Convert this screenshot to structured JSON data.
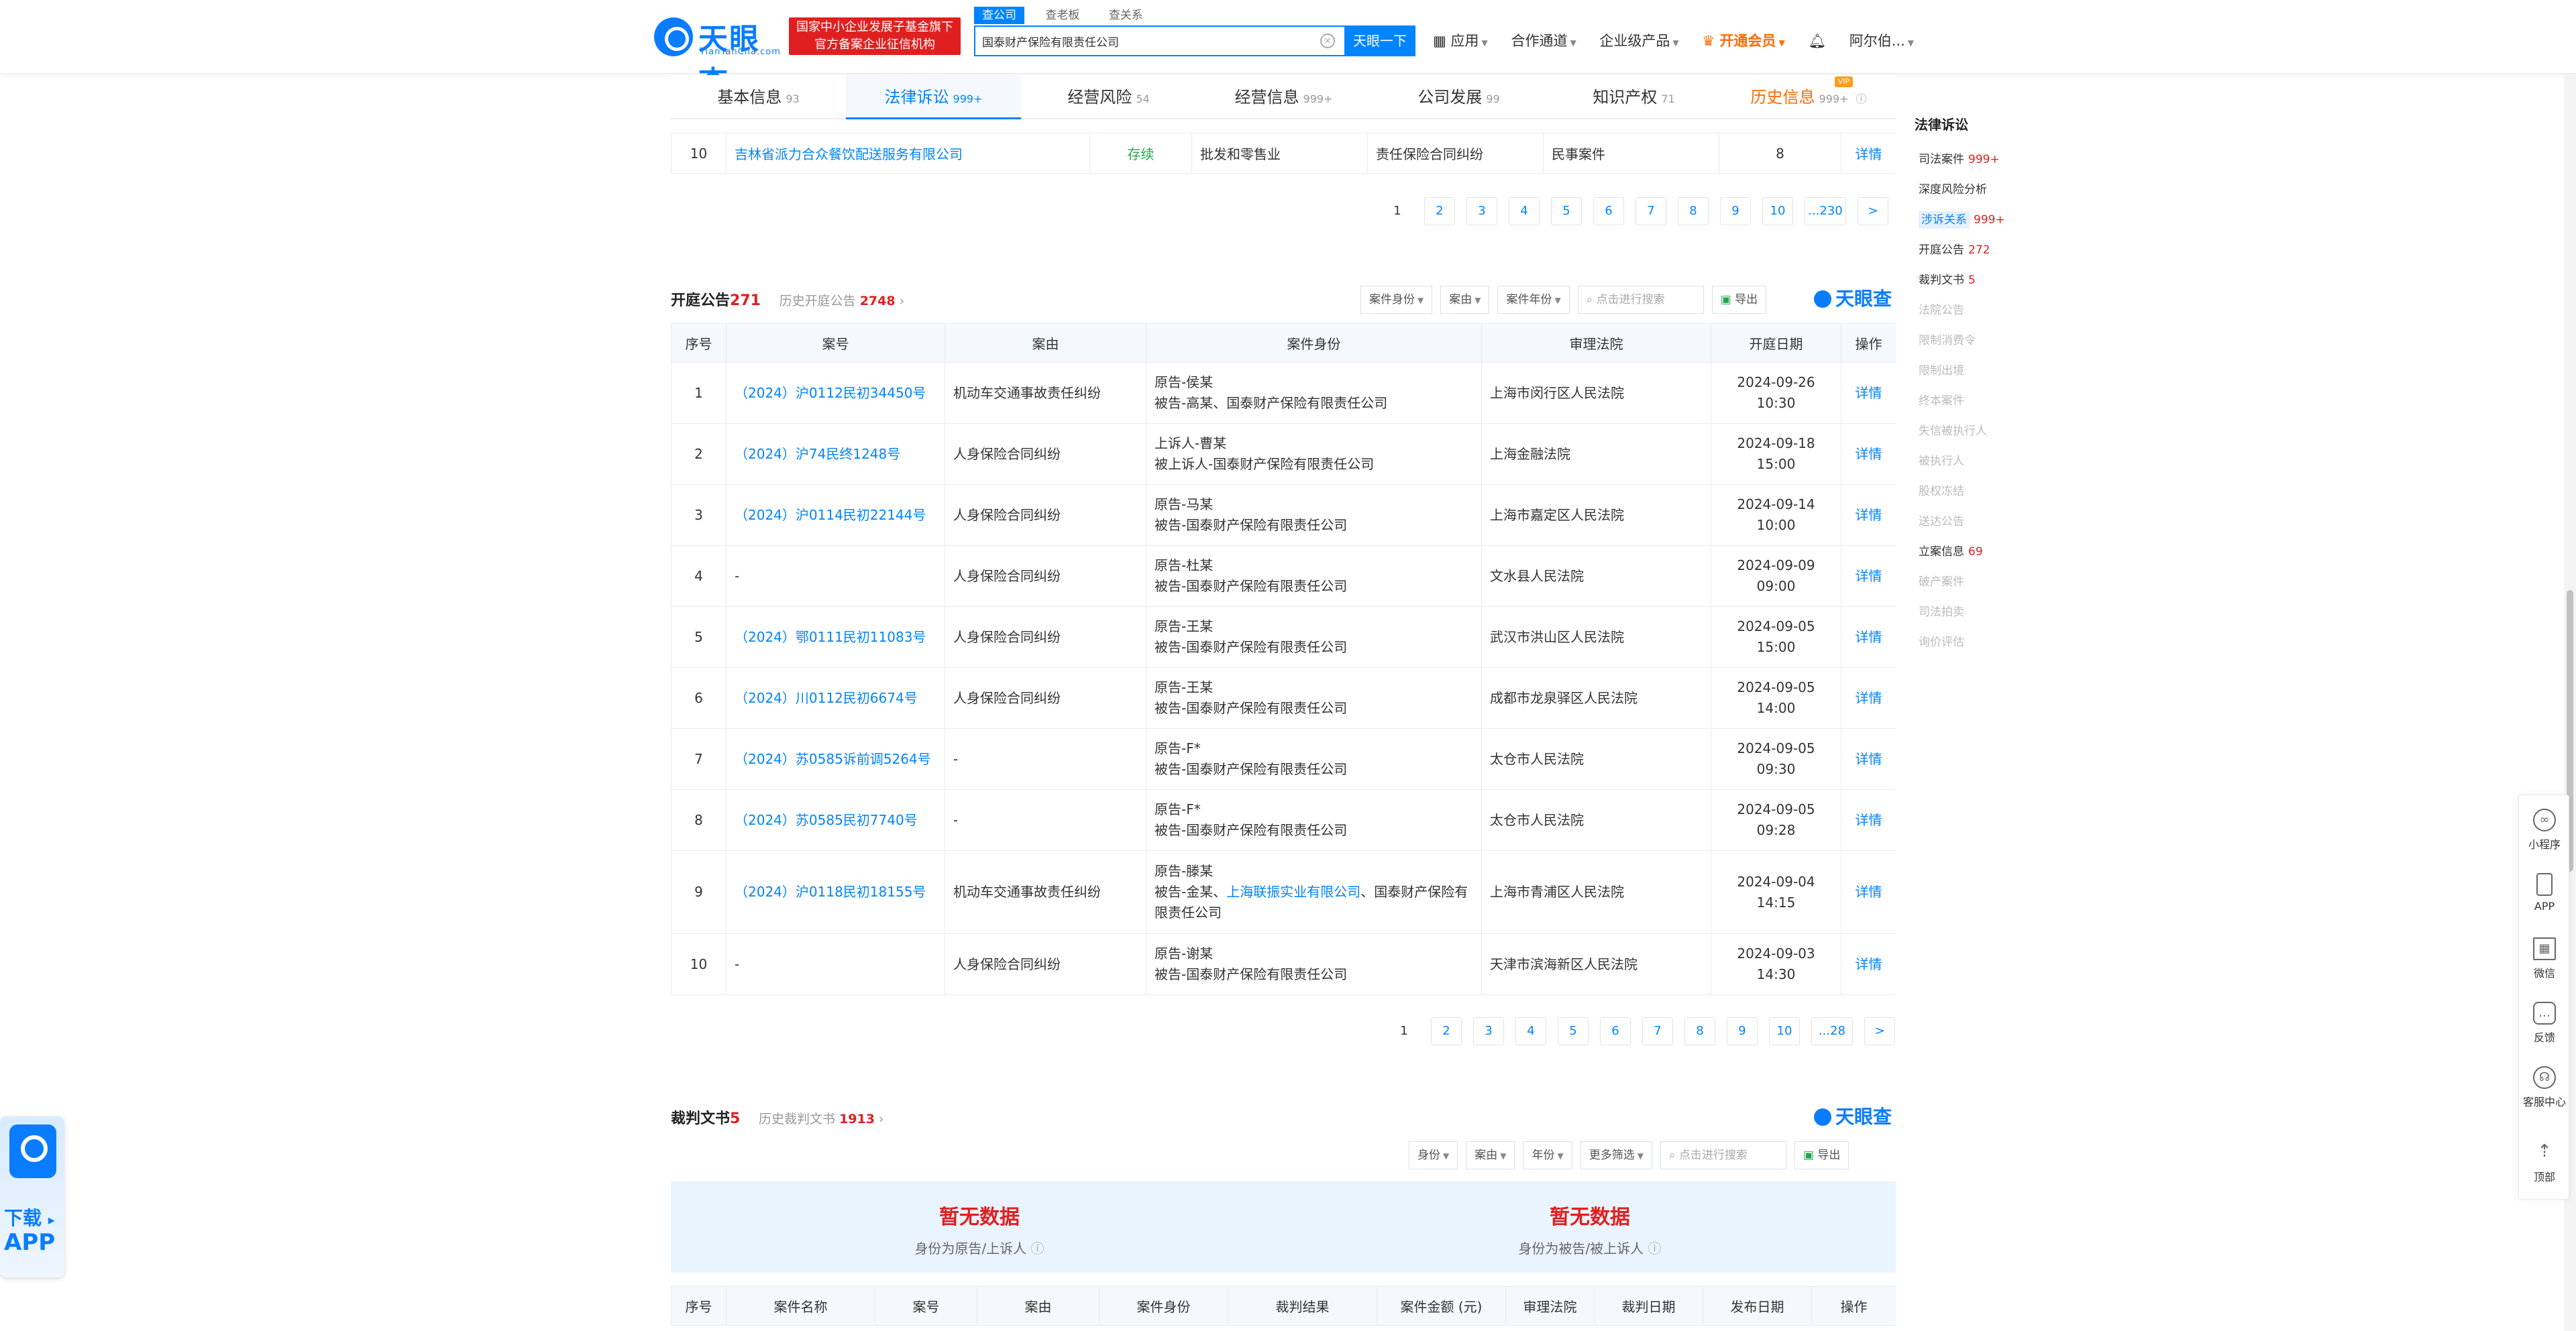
{
  "header": {
    "logo_text": "天眼查",
    "logo_sub": "TianYanCha.com",
    "org_badge_line1": "国家中小企业发展子基金旗下",
    "org_badge_line2": "官方备案企业征信机构",
    "search_tabs": [
      "查公司",
      "查老板",
      "查关系"
    ],
    "search_value": "国泰财产保险有限责任公司",
    "search_button": "天眼一下",
    "nav": [
      "应用",
      "合作通道",
      "企业级产品",
      "开通会员",
      "阿尔伯..."
    ]
  },
  "tabs": [
    {
      "label": "基本信息",
      "count": "93"
    },
    {
      "label": "法律诉讼",
      "count": "999+"
    },
    {
      "label": "经营风险",
      "count": "54"
    },
    {
      "label": "经营信息",
      "count": "999+"
    },
    {
      "label": "公司发展",
      "count": "99"
    },
    {
      "label": "知识产权",
      "count": "71"
    },
    {
      "label": "历史信息",
      "count": "999+",
      "badge": "VIP"
    }
  ],
  "prev_row": {
    "no": "10",
    "company": "吉林省派力合众餐饮配送服务有限公司",
    "status": "存续",
    "industry": "批发和零售业",
    "cause": "责任保险合同纠纷",
    "type": "民事案件",
    "count": "8",
    "action": "详情"
  },
  "pager1": [
    "1",
    "2",
    "3",
    "4",
    "5",
    "6",
    "7",
    "8",
    "9",
    "10",
    "...230",
    ">"
  ],
  "hearing": {
    "title": "开庭公告",
    "count": "271",
    "hist_label": "历史开庭公告",
    "hist_count": "2748",
    "filters": [
      "案件身份",
      "案由",
      "案件年份"
    ],
    "search_placeholder": "点击进行搜索",
    "export": "导出",
    "brand": "天眼查",
    "columns": [
      "序号",
      "案号",
      "案由",
      "案件身份",
      "审理法院",
      "开庭日期",
      "操作"
    ],
    "rows": [
      {
        "no": "1",
        "case": "（2024）沪0112民初34450号",
        "cause": "机动车交通事故责任纠纷",
        "party1": "原告-侯某",
        "party2": "被告-高某、国泰财产保险有限责任公司",
        "court": "上海市闵行区人民法院",
        "date": "2024-09-26 10:30",
        "action": "详情"
      },
      {
        "no": "2",
        "case": "（2024）沪74民终1248号",
        "cause": "人身保险合同纠纷",
        "party1": "上诉人-曹某",
        "party2": "被上诉人-国泰财产保险有限责任公司",
        "court": "上海金融法院",
        "date": "2024-09-18 15:00",
        "action": "详情"
      },
      {
        "no": "3",
        "case": "（2024）沪0114民初22144号",
        "cause": "人身保险合同纠纷",
        "party1": "原告-马某",
        "party2": "被告-国泰财产保险有限责任公司",
        "court": "上海市嘉定区人民法院",
        "date": "2024-09-14 10:00",
        "action": "详情"
      },
      {
        "no": "4",
        "case": "-",
        "cause": "人身保险合同纠纷",
        "party1": "原告-杜某",
        "party2": "被告-国泰财产保险有限责任公司",
        "court": "文水县人民法院",
        "date": "2024-09-09 09:00",
        "action": "详情"
      },
      {
        "no": "5",
        "case": "（2024）鄂0111民初11083号",
        "cause": "人身保险合同纠纷",
        "party1": "原告-王某",
        "party2": "被告-国泰财产保险有限责任公司",
        "court": "武汉市洪山区人民法院",
        "date": "2024-09-05 15:00",
        "action": "详情"
      },
      {
        "no": "6",
        "case": "（2024）川0112民初6674号",
        "cause": "人身保险合同纠纷",
        "party1": "原告-王某",
        "party2": "被告-国泰财产保险有限责任公司",
        "court": "成都市龙泉驿区人民法院",
        "date": "2024-09-05 14:00",
        "action": "详情"
      },
      {
        "no": "7",
        "case": "（2024）苏0585诉前调5264号",
        "cause": "-",
        "party1": "原告-F*",
        "party2": "被告-国泰财产保险有限责任公司",
        "court": "太仓市人民法院",
        "date": "2024-09-05 09:30",
        "action": "详情"
      },
      {
        "no": "8",
        "case": "（2024）苏0585民初7740号",
        "cause": "-",
        "party1": "原告-F*",
        "party2": "被告-国泰财产保险有限责任公司",
        "court": "太仓市人民法院",
        "date": "2024-09-05 09:28",
        "action": "详情"
      },
      {
        "no": "9",
        "case": "（2024）沪0118民初18155号",
        "cause": "机动车交通事故责任纠纷",
        "party1": "原告-滕某",
        "party2_pre": "被告-金某、",
        "party2_link": "上海联振实业有限公司",
        "party2_post": "、国泰财产保险有限责任公司",
        "court": "上海市青浦区人民法院",
        "date": "2024-09-04 14:15",
        "action": "详情"
      },
      {
        "no": "10",
        "case": "-",
        "cause": "人身保险合同纠纷",
        "party1": "原告-谢某",
        "party2": "被告-国泰财产保险有限责任公司",
        "court": "天津市滨海新区人民法院",
        "date": "2024-09-03 14:30",
        "action": "详情"
      }
    ]
  },
  "pager2": [
    "1",
    "2",
    "3",
    "4",
    "5",
    "6",
    "7",
    "8",
    "9",
    "10",
    "...28",
    ">"
  ],
  "judgment": {
    "title": "裁判文书",
    "count": "5",
    "hist_label": "历史裁判文书",
    "hist_count": "1913",
    "filters": [
      "身份",
      "案由",
      "年份",
      "更多筛选"
    ],
    "search_placeholder": "点击进行搜索",
    "export": "导出",
    "brand": "天眼查",
    "nodata_left_title": "暂无数据",
    "nodata_left_sub": "身份为原告/上诉人",
    "nodata_right_title": "暂无数据",
    "nodata_right_sub": "身份为被告/被上诉人",
    "columns": [
      "序号",
      "案件名称",
      "案号",
      "案由",
      "案件身份",
      "裁判结果",
      "案件金额 (元)",
      "审理法院",
      "裁判日期",
      "发布日期",
      "操作"
    ]
  },
  "toc": {
    "title": "法律诉讼",
    "items": [
      {
        "label": "司法案件",
        "count": "999+"
      },
      {
        "label": "深度风险分析",
        "count": ""
      },
      {
        "label": "涉诉关系",
        "count": "999+"
      },
      {
        "label": "开庭公告",
        "count": "272"
      },
      {
        "label": "裁判文书",
        "count": "5"
      },
      {
        "label": "法院公告",
        "count": ""
      },
      {
        "label": "限制消费令",
        "count": ""
      },
      {
        "label": "限制出境",
        "count": ""
      },
      {
        "label": "终本案件",
        "count": ""
      },
      {
        "label": "失信被执行人",
        "count": ""
      },
      {
        "label": "被执行人",
        "count": ""
      },
      {
        "label": "股权冻结",
        "count": ""
      },
      {
        "label": "送达公告",
        "count": ""
      },
      {
        "label": "立案信息",
        "count": "69"
      },
      {
        "label": "破产案件",
        "count": ""
      },
      {
        "label": "司法拍卖",
        "count": ""
      },
      {
        "label": "询价评估",
        "count": ""
      }
    ]
  },
  "float_bar": [
    "小程序",
    "APP",
    "微信",
    "反馈",
    "客服中心",
    "顶部"
  ],
  "download": {
    "line1": "下载",
    "line2": "APP"
  }
}
